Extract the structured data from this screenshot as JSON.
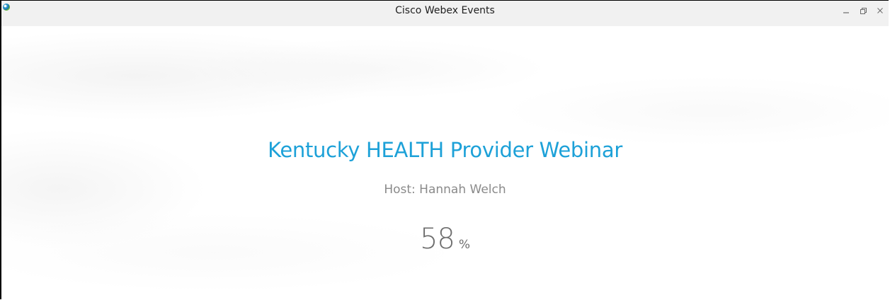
{
  "window": {
    "title": "Cisco Webex Events",
    "controls": {
      "minimize_icon": "minimize-icon",
      "restore_icon": "restore-icon",
      "close_icon": "close-icon"
    }
  },
  "event": {
    "title": "Kentucky HEALTH Provider Webinar",
    "host": "Host: Hannah Welch"
  },
  "loading": {
    "progress_value": "58",
    "progress_unit": "%",
    "progress_percent": 58
  },
  "colors": {
    "accent": "#1da1d8",
    "secondary_text": "#8a8a8a",
    "progress_text": "#6e6e6e",
    "titlebar_bg": "#f1f1f1"
  }
}
